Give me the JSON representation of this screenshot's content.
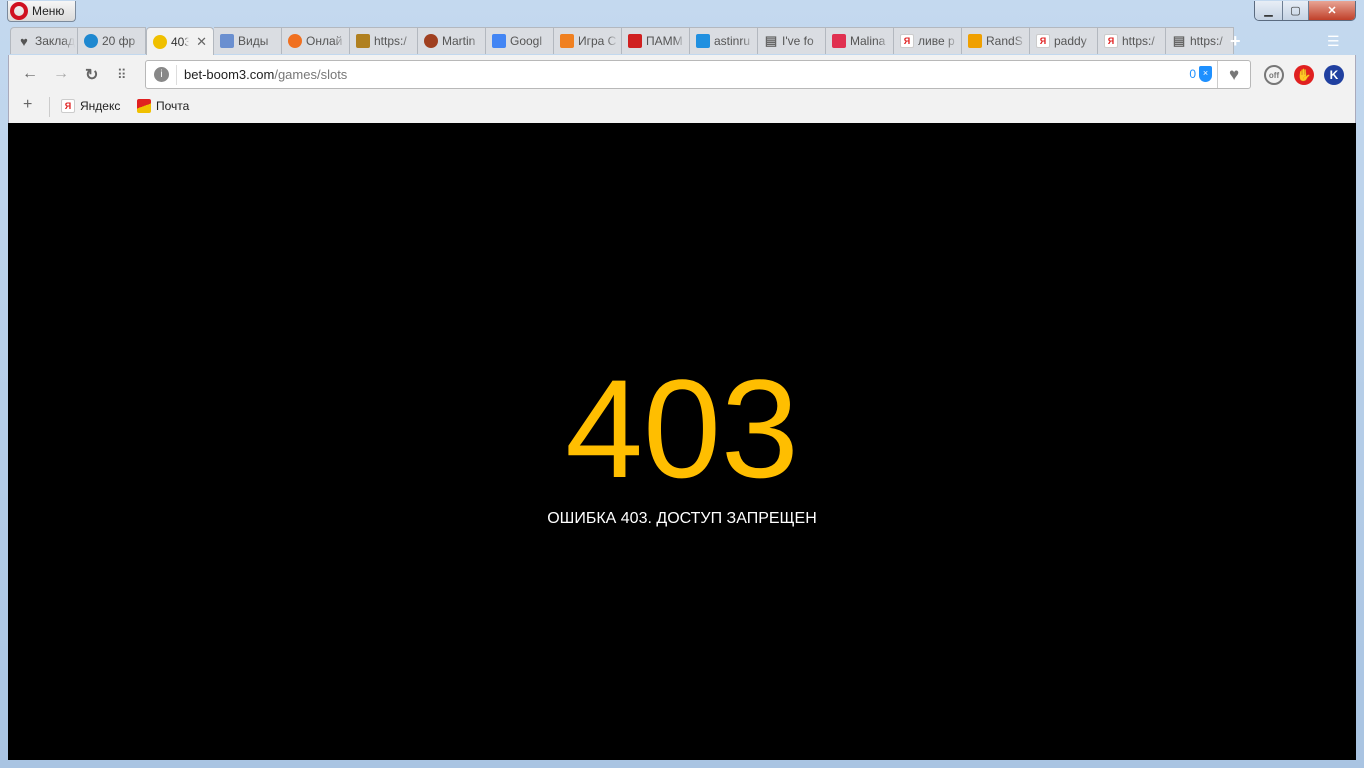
{
  "window": {
    "menu_label": "Меню",
    "controls": [
      "minimize",
      "maximize",
      "close"
    ]
  },
  "tabs": [
    {
      "label": "Заклад",
      "icon": "heart-icon",
      "color": "#555555"
    },
    {
      "label": "20 фр",
      "icon": "kf-icon",
      "color": "#1e88d0"
    },
    {
      "label": "403",
      "icon": "coin-icon",
      "color": "#f0c000",
      "active": true
    },
    {
      "label": "Виды",
      "icon": "cards-icon",
      "color": "#6a8fd0"
    },
    {
      "label": "Онлай",
      "icon": "lifebuoy-icon",
      "color": "#f07020"
    },
    {
      "label": "https:/",
      "icon": "game-icon",
      "color": "#b08020"
    },
    {
      "label": "Martin",
      "icon": "roulette-icon",
      "color": "#a04020"
    },
    {
      "label": "Googl",
      "icon": "google-translate-icon",
      "color": "#4285f4"
    },
    {
      "label": "Игра С",
      "icon": "star-icon",
      "color": "#f08020"
    },
    {
      "label": "ПАММ",
      "icon": "p-icon",
      "color": "#d02020"
    },
    {
      "label": "astinru",
      "icon": "at-icon",
      "color": "#2090e0"
    },
    {
      "label": "I've fo",
      "icon": "page-icon",
      "color": "#666666"
    },
    {
      "label": "Malina",
      "icon": "raspberry-icon",
      "color": "#e03050"
    },
    {
      "label": "ливе р",
      "icon": "yandex-icon",
      "color": "#e02020"
    },
    {
      "label": "RandS",
      "icon": "rs-icon",
      "color": "#f0a000"
    },
    {
      "label": "paddy",
      "icon": "yandex-icon",
      "color": "#e02020"
    },
    {
      "label": "https:/",
      "icon": "yandex-icon",
      "color": "#e02020"
    },
    {
      "label": "https:/",
      "icon": "page-icon",
      "color": "#666666"
    }
  ],
  "address": {
    "domain": "bet-boom3.com",
    "path": "/games/slots",
    "blocked_count": "0"
  },
  "extensions": [
    {
      "name": "off",
      "color": "#888888"
    },
    {
      "name": "adblock",
      "color": "#e02020"
    },
    {
      "name": "K",
      "color": "#2040a0"
    }
  ],
  "bookmarks": [
    {
      "label": "Яндекс"
    },
    {
      "label": "Почта"
    }
  ],
  "page": {
    "code": "403",
    "message": "ОШИБКА 403. ДОСТУП ЗАПРЕЩЕН",
    "accent": "#ffbe00",
    "background": "#000000"
  }
}
